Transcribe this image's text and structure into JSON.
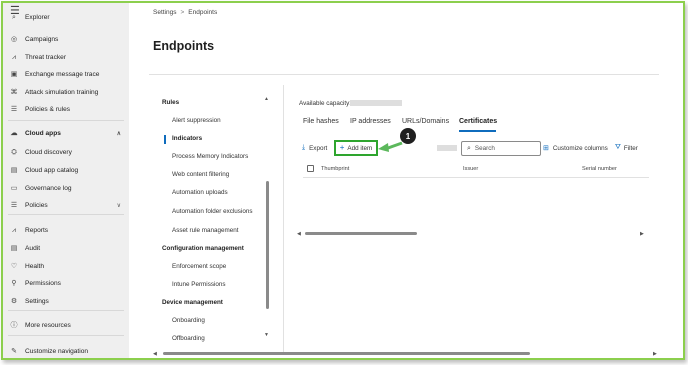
{
  "nav": {
    "top_cut_item": "Explorer",
    "items": [
      {
        "label": "Campaigns",
        "icon": "campaigns-icon",
        "glyph": "◎"
      },
      {
        "label": "Threat tracker",
        "icon": "threat-tracker-icon",
        "glyph": "⩘"
      },
      {
        "label": "Exchange message trace",
        "icon": "message-trace-icon",
        "glyph": "▣"
      },
      {
        "label": "Attack simulation training",
        "icon": "attack-simulation-icon",
        "glyph": "⌘"
      },
      {
        "label": "Policies & rules",
        "icon": "policies-rules-icon",
        "glyph": "☰"
      },
      {
        "label": "Cloud apps",
        "icon": "cloud-apps-icon",
        "glyph": "☁"
      },
      {
        "label": "Cloud discovery",
        "icon": "cloud-discovery-icon",
        "glyph": "⛭"
      },
      {
        "label": "Cloud app catalog",
        "icon": "cloud-app-catalog-icon",
        "glyph": "▤"
      },
      {
        "label": "Governance log",
        "icon": "governance-log-icon",
        "glyph": "▭"
      },
      {
        "label": "Policies",
        "icon": "policies-icon",
        "glyph": "☰"
      },
      {
        "label": "Reports",
        "icon": "reports-icon",
        "glyph": "⩘"
      },
      {
        "label": "Audit",
        "icon": "audit-icon",
        "glyph": "▤"
      },
      {
        "label": "Health",
        "icon": "health-icon",
        "glyph": "♡"
      },
      {
        "label": "Permissions",
        "icon": "permissions-icon",
        "glyph": "⚲"
      },
      {
        "label": "Settings",
        "icon": "settings-icon",
        "glyph": "⚙"
      },
      {
        "label": "More resources",
        "icon": "more-resources-icon",
        "glyph": "ⓘ"
      },
      {
        "label": "Customize navigation",
        "icon": "customize-navigation-icon",
        "glyph": "✎"
      }
    ]
  },
  "breadcrumb": {
    "parent": "Settings",
    "separator": ">",
    "current": "Endpoints"
  },
  "page_title": "Endpoints",
  "settings_list": {
    "sections": [
      {
        "heading": "Rules",
        "items": [
          "Alert suppression",
          "Indicators",
          "Process Memory Indicators",
          "Web content filtering",
          "Automation uploads",
          "Automation folder exclusions",
          "Asset rule management"
        ]
      },
      {
        "heading": "Configuration management",
        "items": [
          "Enforcement scope",
          "Intune Permissions"
        ]
      },
      {
        "heading": "Device management",
        "items": [
          "Onboarding",
          "Offboarding"
        ]
      }
    ],
    "active_item": "Indicators"
  },
  "content": {
    "capacity_label": "Available capacity:",
    "tabs": [
      "File hashes",
      "IP addresses",
      "URLs/Domains",
      "Certificates"
    ],
    "selected_tab": "Certificates",
    "toolbar": {
      "export_label": "Export",
      "add_item_label": "Add item",
      "search_placeholder": "Search",
      "customize_columns_label": "Customize columns",
      "filter_label": "Filter"
    },
    "callout_number": "1",
    "table_columns": [
      "Thumbprint",
      "Issuer",
      "Serial number"
    ]
  },
  "colors": {
    "accent": "#0f6cbd",
    "highlight": "#2ea52e",
    "frame": "#8ccf4d"
  }
}
